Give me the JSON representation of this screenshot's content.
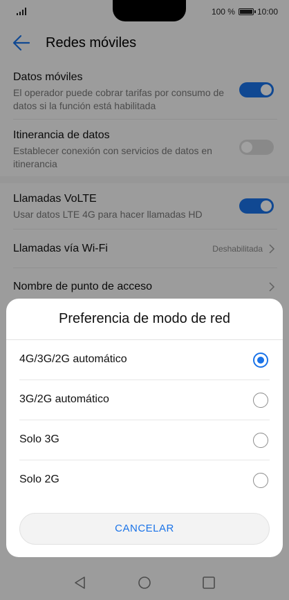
{
  "status_bar": {
    "battery_text": "100 %",
    "time": "10:00"
  },
  "header": {
    "title": "Redes móviles"
  },
  "settings": {
    "mobile_data": {
      "title": "Datos móviles",
      "subtitle": "El operador puede cobrar tarifas por consumo de datos si la función está habilitada",
      "enabled": true
    },
    "roaming": {
      "title": "Itinerancia de datos",
      "subtitle": "Establecer conexión con servicios de datos en itinerancia",
      "enabled": false
    },
    "volte": {
      "title": "Llamadas VoLTE",
      "subtitle": "Usar datos LTE 4G para hacer llamadas HD",
      "enabled": true
    },
    "wifi_calls": {
      "title": "Llamadas vía Wi-Fi",
      "value": "Deshabilitada"
    },
    "apn": {
      "title": "Nombre de punto de acceso"
    }
  },
  "dialog": {
    "title": "Preferencia de modo de red",
    "options": [
      {
        "label": "4G/3G/2G automático",
        "selected": true
      },
      {
        "label": "3G/2G automático",
        "selected": false
      },
      {
        "label": "Solo 3G",
        "selected": false
      },
      {
        "label": "Solo 2G",
        "selected": false
      }
    ],
    "cancel_label": "CANCELAR"
  },
  "colors": {
    "accent": "#1a73e8",
    "toggle_off": "#d9d9d9",
    "scrim": "rgba(0,0,0,0.37)"
  },
  "icons": [
    "signal-icon",
    "battery-icon",
    "back-arrow-icon",
    "chevron-right-icon",
    "nav-back-icon",
    "nav-home-icon",
    "nav-recents-icon"
  ]
}
